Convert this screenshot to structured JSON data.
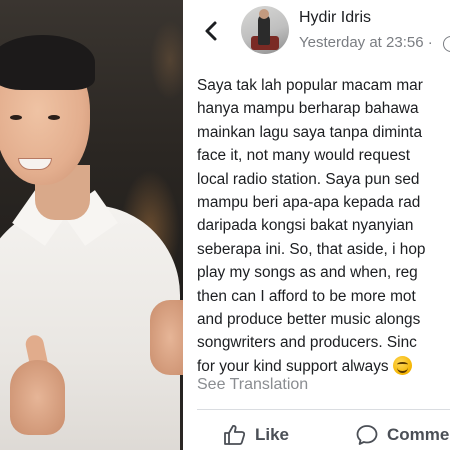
{
  "photo": {
    "alt_subject": "portrait"
  },
  "post": {
    "author": "Hydir Idris",
    "timestamp": "Yesterday at 23:56 ·",
    "body_lines": [
      "Saya tak lah popular macam mar",
      "hanya mampu berharap bahawa",
      "mainkan lagu saya tanpa diminta",
      "face it, not many would request",
      "local radio station. Saya pun sed",
      "mampu beri apa-apa kepada rad",
      "daripada kongsi bakat nyanyian",
      "seberapa ini. So, that aside, i hop",
      "play my songs as and when, reg",
      "then can I afford to be more mot",
      "and produce better music alongs",
      "songwriters and producers. Sinc",
      "for your kind support always"
    ],
    "see_translation": "See Translation",
    "actions": {
      "like": "Like",
      "comment": "Comme"
    }
  },
  "icons": {
    "back": "chevron-left-icon",
    "globe": "globe-icon",
    "like": "thumbs-up-icon",
    "comment": "comment-bubble-icon",
    "emoji": "smiling-face-emoji"
  },
  "colors": {
    "text": "#1c1e21",
    "muted": "#7a7d82",
    "action": "#4b4f56",
    "divider": "#dadde1"
  }
}
